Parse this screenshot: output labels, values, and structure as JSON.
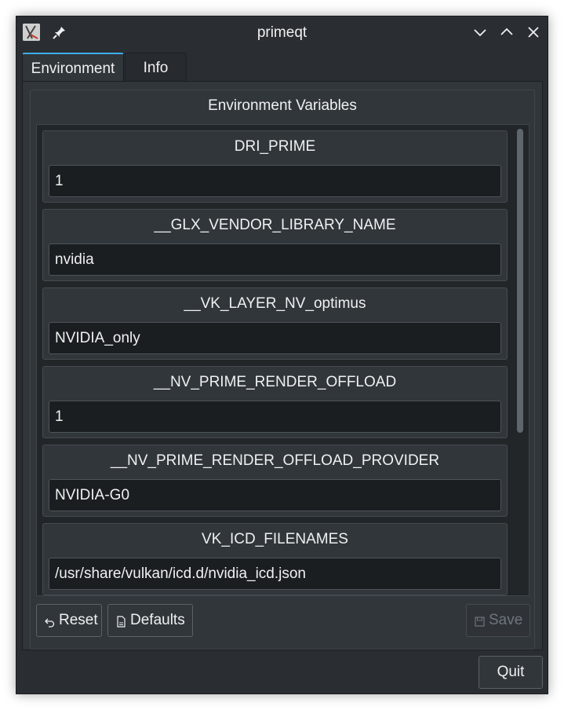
{
  "window": {
    "title": "primeqt",
    "app_icon": "app-icon",
    "pin_icon": "pin-icon",
    "controls": [
      "minimize-icon",
      "maximize-icon",
      "close-icon"
    ]
  },
  "tabs": [
    {
      "label": "Environment",
      "active": true
    },
    {
      "label": "Info",
      "active": false
    }
  ],
  "environment": {
    "group_title": "Environment Variables",
    "variables": [
      {
        "name": "DRI_PRIME",
        "value": "1"
      },
      {
        "name": "__GLX_VENDOR_LIBRARY_NAME",
        "value": "nvidia"
      },
      {
        "name": "__VK_LAYER_NV_optimus",
        "value": "NVIDIA_only"
      },
      {
        "name": "__NV_PRIME_RENDER_OFFLOAD",
        "value": "1"
      },
      {
        "name": "__NV_PRIME_RENDER_OFFLOAD_PROVIDER",
        "value": "NVIDIA-G0"
      },
      {
        "name": "VK_ICD_FILENAMES",
        "value": "/usr/share/vulkan/icd.d/nvidia_icd.json"
      }
    ],
    "buttons": {
      "reset": {
        "label": "Reset",
        "icon": "undo-icon"
      },
      "defaults": {
        "label": "Defaults",
        "icon": "document-icon"
      },
      "save": {
        "label": "Save",
        "icon": "floppy-icon",
        "enabled": false
      }
    }
  },
  "footer": {
    "quit_label": "Quit"
  },
  "colors": {
    "window_bg": "#2a2e32",
    "panel_bg": "#31363b",
    "input_bg": "#1b1e20",
    "accent": "#3daee9",
    "text": "#eff0f1"
  }
}
